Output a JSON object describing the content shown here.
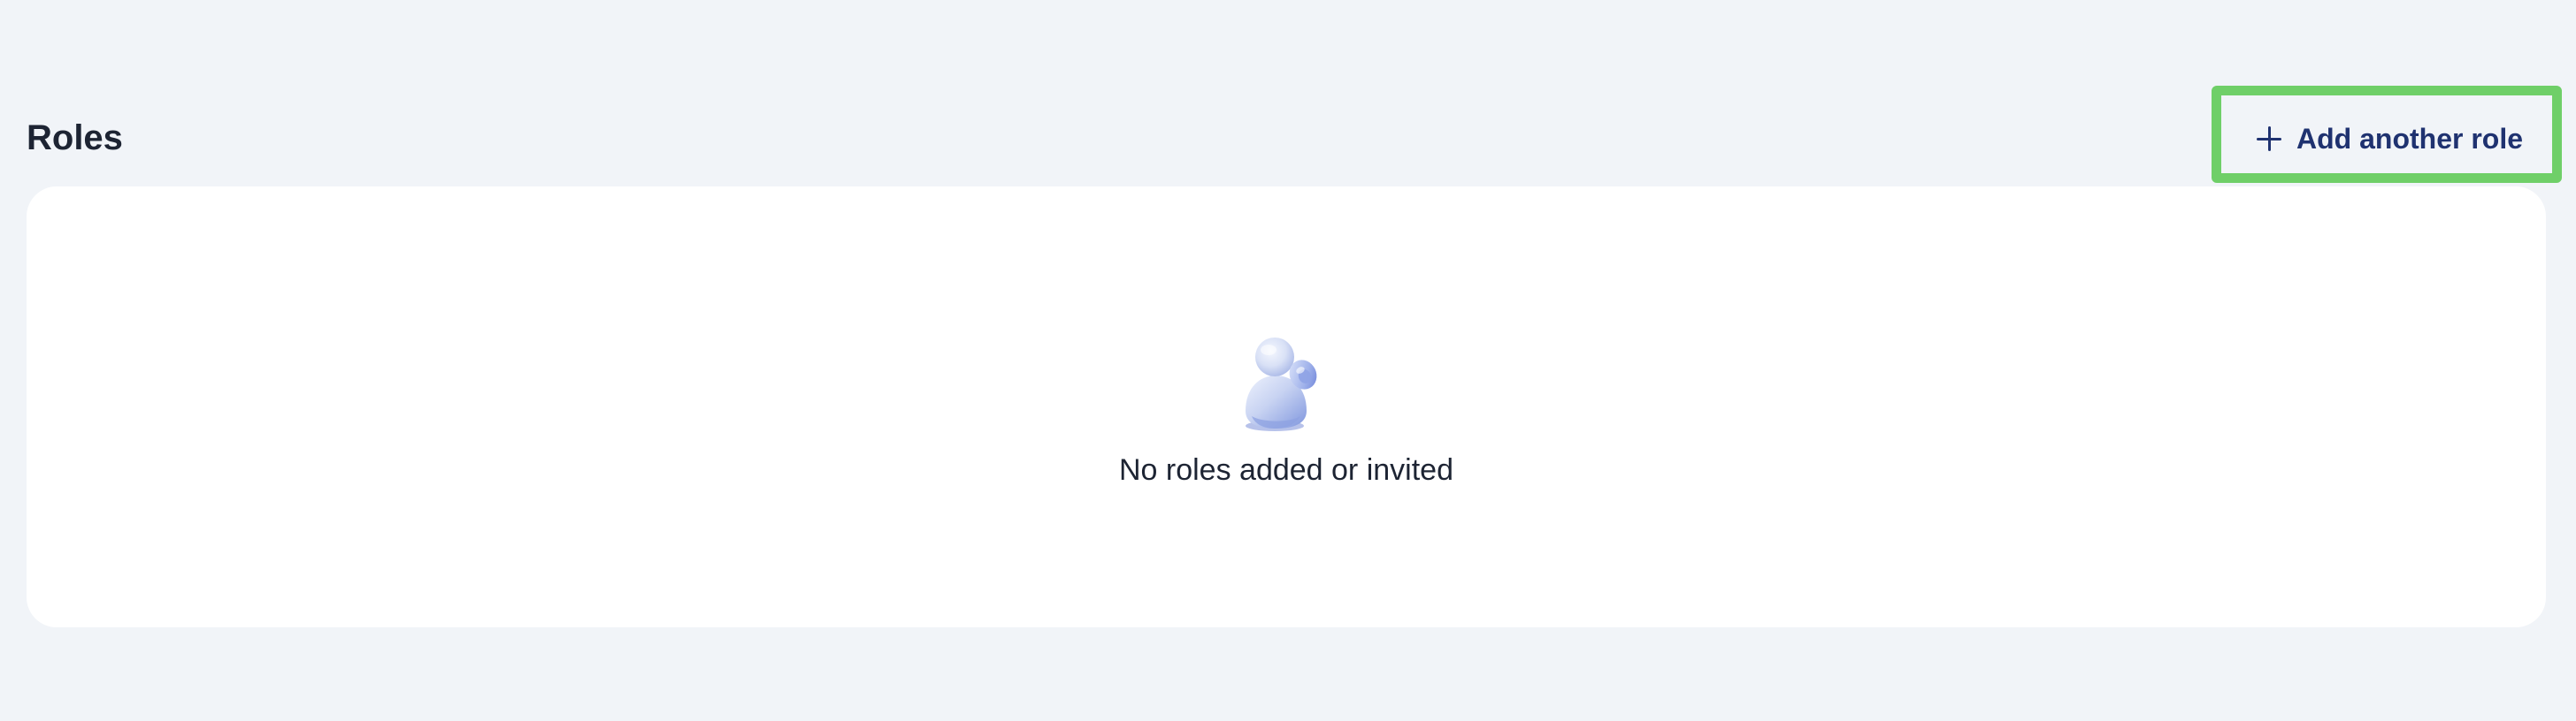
{
  "page": {
    "title": "Roles"
  },
  "toolbar": {
    "add_role_label": "Add another role",
    "add_icon": "plus-icon"
  },
  "empty_state": {
    "icon": "person-icon",
    "message": "No roles added or invited"
  },
  "colors": {
    "background": "#f1f4f8",
    "card": "#ffffff",
    "title_text": "#1d2433",
    "button_text": "#1f3270",
    "highlight": "#6fcf68",
    "icon_light": "#d6def3",
    "icon_mid": "#9fb2e6",
    "icon_dark": "#6f86d6"
  }
}
